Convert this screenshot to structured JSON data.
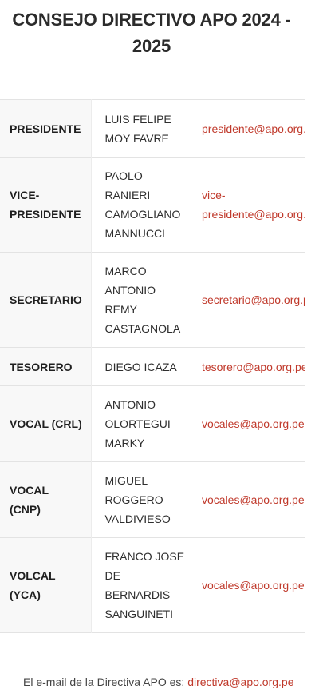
{
  "title": {
    "line1": "CONSEJO DIRECTIVO APO 2024 -",
    "line2": "2025"
  },
  "board": [
    {
      "role": "PRESIDENTE",
      "name": "LUIS FELIPE MOY FAVRE",
      "email": "presidente@apo.org.pe"
    },
    {
      "role": "VICE-PRESIDENTE",
      "name": "PAOLO RANIERI CAMOGLIANO MANNUCCI",
      "email": "vice-presidente@apo.org.pe"
    },
    {
      "role": "SECRETARIO",
      "name": "MARCO ANTONIO REMY CASTAGNOLA",
      "email": "secretario@apo.org.pe"
    },
    {
      "role": "TESORERO",
      "name": "DIEGO ICAZA",
      "email": "tesorero@apo.org.pe"
    },
    {
      "role": "VOCAL (CRL)",
      "name": "ANTONIO OLORTEGUI MARKY",
      "email": "vocales@apo.org.pe"
    },
    {
      "role": "VOCAL (CNP)",
      "name": "MIGUEL ROGGERO VALDIVIESO",
      "email": "vocales@apo.org.pe"
    },
    {
      "role": "VOLCAL (YCA)",
      "name": "FRANCO JOSE DE BERNARDIS SANGUINETI",
      "email": "vocales@apo.org.pe"
    }
  ],
  "footer": {
    "text": "El e-mail de la Directiva APO es:",
    "email": "directiva@apo.org.pe"
  },
  "colors": {
    "link": "#c0392b",
    "role_background": "#f8f8f8",
    "border": "#e3e3e3"
  }
}
